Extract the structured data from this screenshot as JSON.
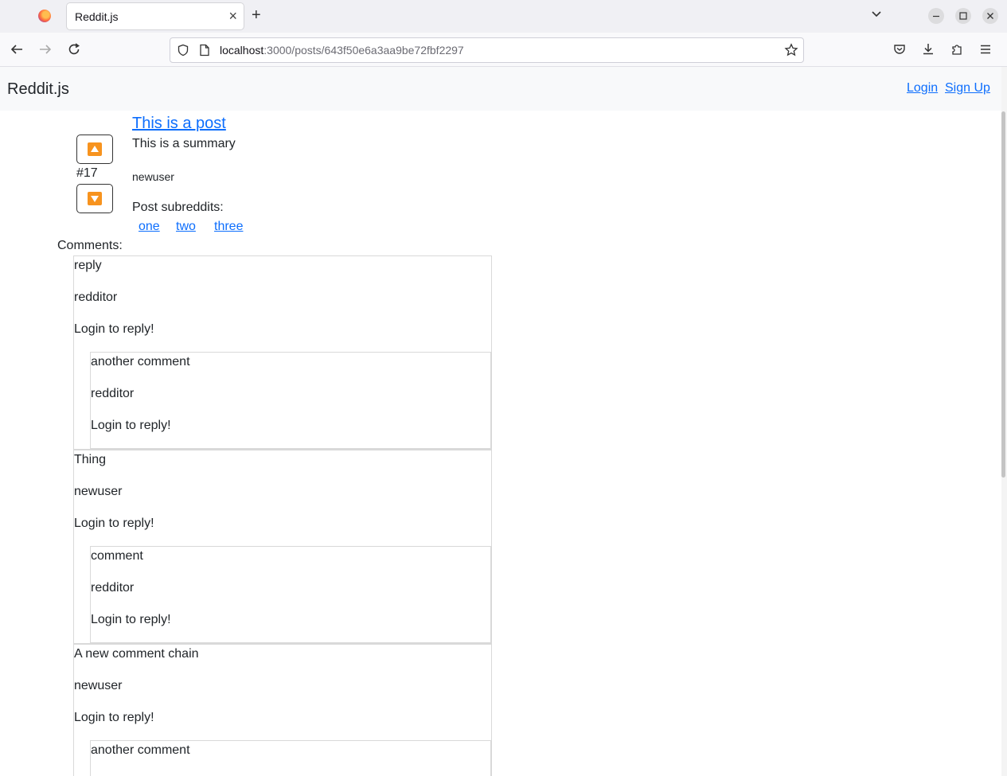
{
  "browser": {
    "tab_title": "Reddit.js",
    "tab_close": "×",
    "new_tab": "+",
    "url_host": "localhost",
    "url_rest": ":3000/posts/643f50e6a3aa9be72fbf2297"
  },
  "site": {
    "brand": "Reddit.js",
    "login": "Login",
    "signup": "Sign Up"
  },
  "post": {
    "title": "This is a post",
    "summary": "This is a summary",
    "vote_count": "#17",
    "author": "newuser",
    "subreddits_label": "Post subreddits:",
    "subreddits": [
      "one",
      "two",
      "three"
    ]
  },
  "comments_label": "Comments:",
  "comments": [
    {
      "text": "reply",
      "author": "redditor",
      "reply_prompt": "Login to reply!",
      "children": [
        {
          "text": "another comment",
          "author": "redditor",
          "reply_prompt": "Login to reply!"
        }
      ]
    },
    {
      "text": "Thing",
      "author": "newuser",
      "reply_prompt": "Login to reply!",
      "children": [
        {
          "text": "comment",
          "author": "redditor",
          "reply_prompt": "Login to reply!"
        }
      ]
    },
    {
      "text": "A new comment chain",
      "author": "newuser",
      "reply_prompt": "Login to reply!",
      "children": [
        {
          "text": "another comment"
        }
      ]
    }
  ]
}
